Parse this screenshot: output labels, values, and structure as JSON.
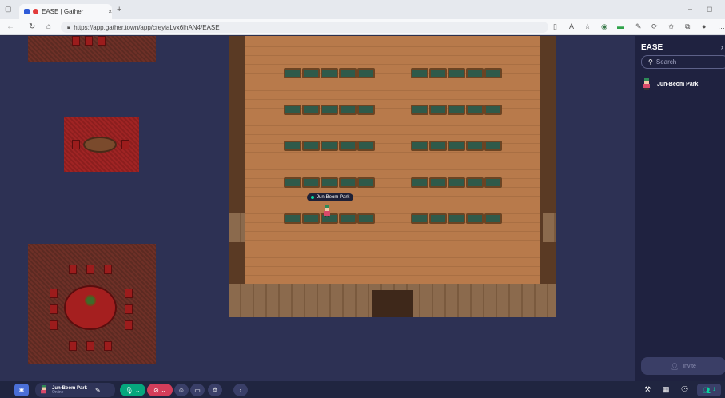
{
  "browser": {
    "tab_title": "EASE | Gather",
    "url": "https://app.gather.town/app/creyiaLvx6lhAN4/EASE"
  },
  "map": {
    "player_name_tag": "Jun-Beom Park"
  },
  "sidebar": {
    "title": "EASE",
    "search_placeholder": "Search",
    "members": [
      {
        "name": "Jun-Beom Park"
      }
    ],
    "invite_label": "Invite"
  },
  "bottom_bar": {
    "user_name": "Jun-Beom Park",
    "user_status": "Online",
    "participants_count": "1"
  },
  "colors": {
    "online": "#06d6a0",
    "sidebar_bg": "#1f2240",
    "map_bg": "#2d3154"
  }
}
